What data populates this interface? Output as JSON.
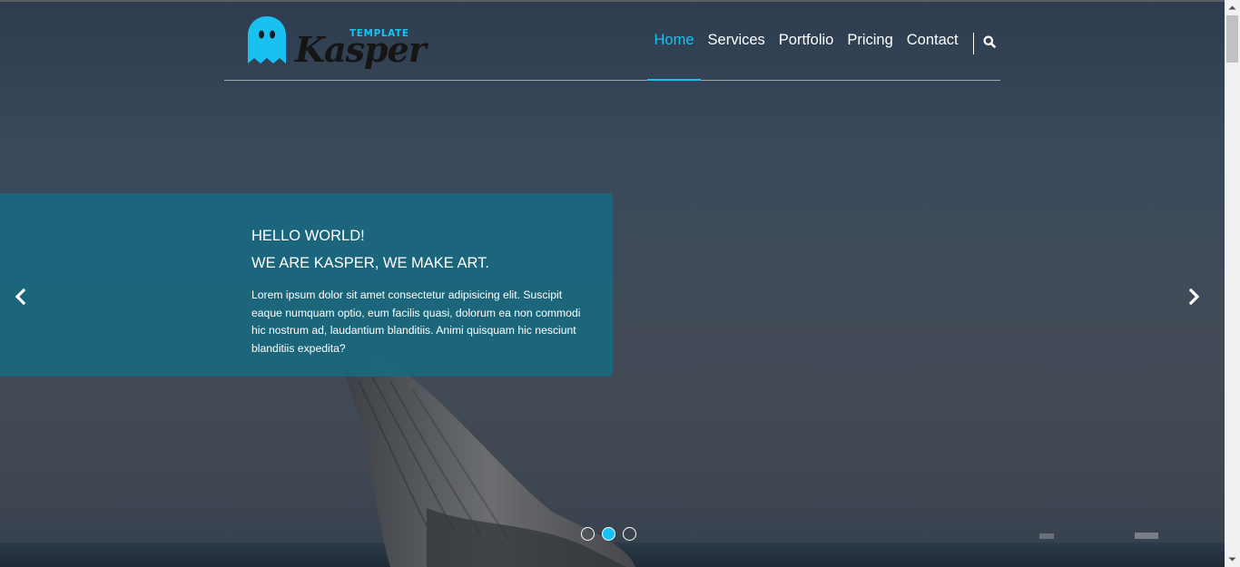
{
  "header": {
    "logo": {
      "subtitle": "TEMPLATE",
      "wordmark": "Kasper",
      "ghost_icon": "ghost-icon",
      "accent_color": "#19c1f1"
    },
    "nav": [
      {
        "label": "Home",
        "active": true
      },
      {
        "label": "Services",
        "active": false
      },
      {
        "label": "Portfolio",
        "active": false
      },
      {
        "label": "Pricing",
        "active": false
      },
      {
        "label": "Contact",
        "active": false
      }
    ],
    "search_icon": "search-icon"
  },
  "slider": {
    "caption": {
      "line1": "HELLO WORLD!",
      "line2": "WE ARE KASPER, WE MAKE ART.",
      "text": "Lorem ipsum dolor sit amet consectetur adipisicing elit. Suscipit eaque numquam optio, eum facilis quasi, dolorum ea non commodi hic nostrum ad, laudantium blanditiis. Animi quisquam hic nesciunt blanditiis expedita?"
    },
    "prev_icon": "chevron-left-icon",
    "next_icon": "chevron-right-icon",
    "slide_count": 3,
    "active_slide": 2,
    "caption_color": "#156c85"
  }
}
